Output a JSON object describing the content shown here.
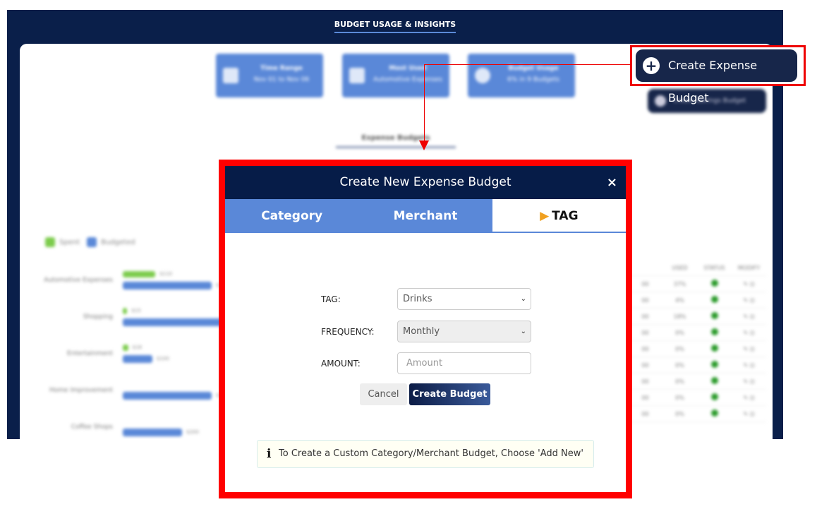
{
  "app": {
    "title": "BUDGET USAGE & INSIGHTS"
  },
  "cards": [
    {
      "icon": "calendar-icon",
      "title": "Time Range",
      "sub": "Nov 01 to Nov 06"
    },
    {
      "icon": "money-icon",
      "title": "Most Used",
      "sub": "Automotive Expenses"
    },
    {
      "icon": "pie-icon",
      "title": "Budget Usage",
      "sub": "6% in 9 Budgets"
    }
  ],
  "buttons": {
    "create_expense": "Create Expense Budget",
    "create_savings": "Create Savings Budget"
  },
  "section_tab": "Expense Budgets",
  "legend": {
    "spent": "Spent",
    "budgeted": "Budgeted"
  },
  "colors": {
    "spent": "#7ccc4c",
    "budgeted": "#5a88d8",
    "navy": "#061c48",
    "accent": "#f0a020",
    "status_ok": "#2a9a2a"
  },
  "chart_data": {
    "type": "bar",
    "categories": [
      "Automotive Expenses",
      "Shopping",
      "Entertainment",
      "Home Improvement",
      "Coffee Shops"
    ],
    "series": [
      {
        "name": "Spent",
        "values": [
          110,
          15,
          18,
          0,
          0
        ]
      },
      {
        "name": "Budgeted",
        "values": [
          300,
          400,
          100,
          300,
          200
        ]
      }
    ],
    "labels": {
      "spent": [
        "$110",
        "$15",
        "$18",
        "",
        ""
      ],
      "budgeted": [
        "$300",
        "",
        "$100",
        "$300",
        "$200"
      ]
    }
  },
  "table": {
    "headers": [
      "USED",
      "STATUS",
      "MODIFY"
    ],
    "rows": [
      [
        "37%"
      ],
      [
        "4%"
      ],
      [
        "18%"
      ],
      [
        "0%"
      ],
      [
        "0%"
      ],
      [
        "0%"
      ],
      [
        "0%"
      ],
      [
        "0%"
      ],
      [
        "0%"
      ]
    ]
  },
  "modal": {
    "title": "Create New Expense Budget",
    "close": "×",
    "tabs": [
      {
        "label": "Category"
      },
      {
        "label": "Merchant"
      },
      {
        "label": "TAG",
        "active": true
      }
    ],
    "fields": {
      "tag_label": "TAG:",
      "tag_value": "Drinks",
      "freq_label": "FREQUENCY:",
      "freq_value": "Monthly",
      "amount_label": "AMOUNT:",
      "amount_placeholder": "Amount"
    },
    "cancel": "Cancel",
    "create": "Create Budget",
    "info": "To Create a Custom Category/Merchant Budget, Choose 'Add New'"
  }
}
